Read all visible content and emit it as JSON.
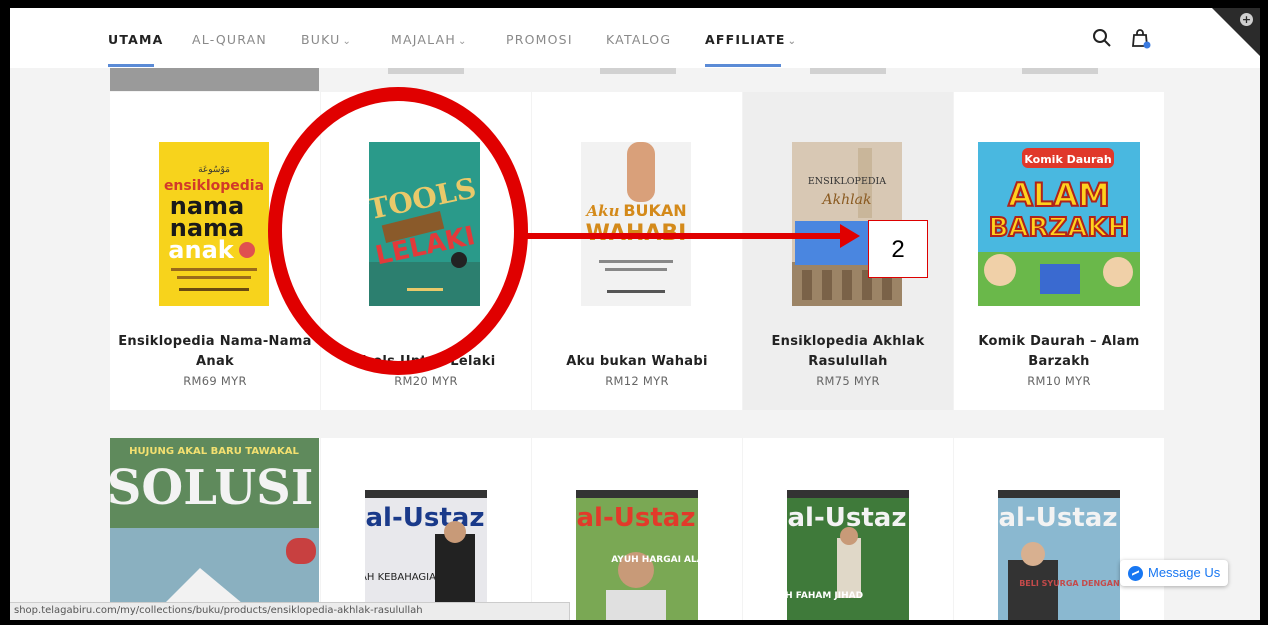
{
  "colors": {
    "accent": "#5b8bd6",
    "annotation": "#e00000",
    "messenger": "#1877f2",
    "highlight_card": "#eeeeee"
  },
  "nav": {
    "items": [
      {
        "label": "UTAMA",
        "chevron": false,
        "active": true
      },
      {
        "label": "AL-QURAN",
        "chevron": false,
        "active": false
      },
      {
        "label": "BUKU",
        "chevron": true,
        "active": false
      },
      {
        "label": "MAJALAH",
        "chevron": true,
        "active": false
      },
      {
        "label": "PROMOSI",
        "chevron": false,
        "active": false
      },
      {
        "label": "KATALOG",
        "chevron": false,
        "active": false
      },
      {
        "label": "AFFILIATE",
        "chevron": true,
        "active": true
      }
    ],
    "chevron_glyph": "⌄",
    "icons": [
      "search-icon",
      "shopping-bag-icon"
    ]
  },
  "products_row1": [
    {
      "title_lines": [
        "Ensiklopedia Nama-Nama",
        "Anak"
      ],
      "price": "RM69 MYR",
      "cover": {
        "bg": "#f7d31c",
        "text": [
          "ensiklopedia",
          "nama",
          "nama",
          "anak"
        ]
      }
    },
    {
      "title_lines": [
        "Tools Untuk Lelaki"
      ],
      "price": "RM20 MYR",
      "cover": {
        "bg": "#2a9a8a",
        "text": [
          "TOOLS",
          "LELAKI"
        ]
      }
    },
    {
      "title_lines": [
        "Aku bukan Wahabi"
      ],
      "price": "RM12 MYR",
      "cover": {
        "bg": "#f2f2f2",
        "text": [
          "Aku",
          "BUKAN",
          "WAHABI"
        ]
      }
    },
    {
      "title_lines": [
        "Ensiklopedia Akhlak",
        "Rasulullah"
      ],
      "price": "RM75 MYR",
      "cover": {
        "bg": "#d8c8b4",
        "text": [
          "ENSIKLOPEDIA",
          "Akhlak"
        ]
      }
    },
    {
      "title_lines": [
        "Komik Daurah – Alam",
        "Barzakh"
      ],
      "price": "RM10 MYR",
      "cover": {
        "bg": "#49b8e0",
        "text": [
          "Komik Daurah",
          "ALAM",
          "BARZAKH"
        ]
      }
    }
  ],
  "magazines_row2": [
    {
      "masthead": "SOLUSI",
      "tag": "HUJUNG AKAL BARU TAWAKAL",
      "bg": "#5f8a5c"
    },
    {
      "masthead": "al-Ustaz",
      "tag": "FIQAH KEBAHAGIAAN",
      "bg": "#e8e8ec"
    },
    {
      "masthead": "al-Ustaz",
      "tag": "AYUH HARGAI ALAM!",
      "bg": "#7aa854"
    },
    {
      "masthead": "al-Ustaz",
      "tag": "SALAH FAHAM JIHAD",
      "bg": "#3f7a3a"
    },
    {
      "masthead": "al-Ustaz",
      "tag": "BELI SYURGA DENGAN HARTA?",
      "bg": "#c44a4a"
    }
  ],
  "annotation": {
    "number": "2"
  },
  "status_url": "shop.telagabiru.com/my/collections/buku/products/ensiklopedia-akhlak-rasulullah",
  "messenger": {
    "label": "Message Us"
  }
}
